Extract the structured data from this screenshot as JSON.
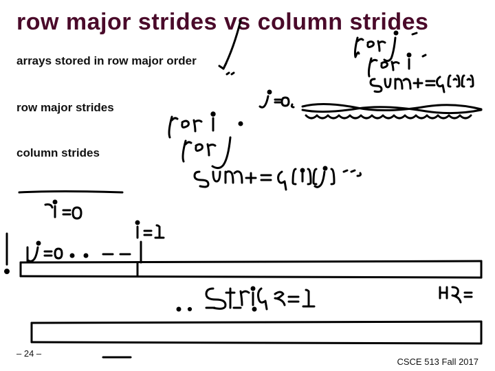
{
  "title": "row major strides vs column strides",
  "lines": {
    "l1": "arrays stored in row major order",
    "l2": "row major strides",
    "l3": "column strides"
  },
  "footer": {
    "page": "– 24 –",
    "course": "CSCE 513 Fall 2017"
  },
  "ink": {
    "annotations": [
      "for j / for i / sum += a[?][?]",
      "for i / for j / sum += a[i][j]",
      "i=0",
      "i=1",
      "j=0 . . ",
      "Stride=1"
    ]
  }
}
